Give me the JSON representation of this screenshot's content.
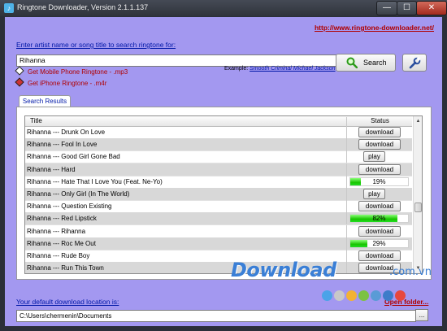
{
  "window": {
    "title": "Ringtone Downloader, Version 2.1.1.137",
    "min_glyph": "—",
    "max_glyph": "☐",
    "close_glyph": "✕"
  },
  "header": {
    "site_link": "http://www.ringtone-downloader.net/",
    "prompt": "Enter artist name or song title to search ringtone for:"
  },
  "search": {
    "value": "Rihanna",
    "button_label": "Search",
    "example_prefix": "Example: ",
    "example_link": "Smooth Criminal Michael Jackson"
  },
  "links": {
    "mobile": "Get Mobile Phone Ringtone - .mp3",
    "iphone": "Get iPhone Ringtone - .m4r"
  },
  "results": {
    "tab_label": "Search Results",
    "col_title": "Title",
    "col_status": "Status",
    "rows": [
      {
        "title": "Rihanna --- Drunk On Love",
        "type": "button",
        "label": "download"
      },
      {
        "title": "Rihanna --- Fool In Love",
        "type": "button",
        "label": "download"
      },
      {
        "title": "Rihanna --- Good Girl Gone Bad",
        "type": "button",
        "label": "play"
      },
      {
        "title": "Rihanna --- Hard",
        "type": "button",
        "label": "download"
      },
      {
        "title": "Rihanna --- Hate That I Love You (Feat. Ne-Yo)",
        "type": "progress",
        "progress": 19,
        "label": "19%"
      },
      {
        "title": "Rihanna --- Only Girl (In The World)",
        "type": "button",
        "label": "play"
      },
      {
        "title": "Rihanna --- Question Existing",
        "type": "button",
        "label": "download"
      },
      {
        "title": "Rihanna --- Red Lipstick",
        "type": "progress",
        "progress": 82,
        "label": "82%"
      },
      {
        "title": "Rihanna --- Rihanna",
        "type": "button",
        "label": "download"
      },
      {
        "title": "Rihanna --- Roc Me Out",
        "type": "progress",
        "progress": 29,
        "label": "29%"
      },
      {
        "title": "Rihanna --- Rude Boy",
        "type": "button",
        "label": "download"
      },
      {
        "title": "Rihanna --- Run This Town",
        "type": "button",
        "label": "download"
      }
    ]
  },
  "footer": {
    "location_label": "Your default download location is:",
    "open_folder": "Open folder...",
    "location_value": "C:\\Users\\chermenin\\Documents",
    "browse_label": "..."
  },
  "watermark": {
    "text": "Download",
    "tld": ".com.vn",
    "dot_colors": [
      "#4aa3e8",
      "#c8c8c8",
      "#f2b234",
      "#7cc242",
      "#5a9bd6",
      "#3d7cc9",
      "#e8473d"
    ]
  },
  "colors": {
    "client_bg": "#a398f0",
    "link_red": "#b00000",
    "link_blue": "#0018a8",
    "progress_green": "#18c400"
  }
}
